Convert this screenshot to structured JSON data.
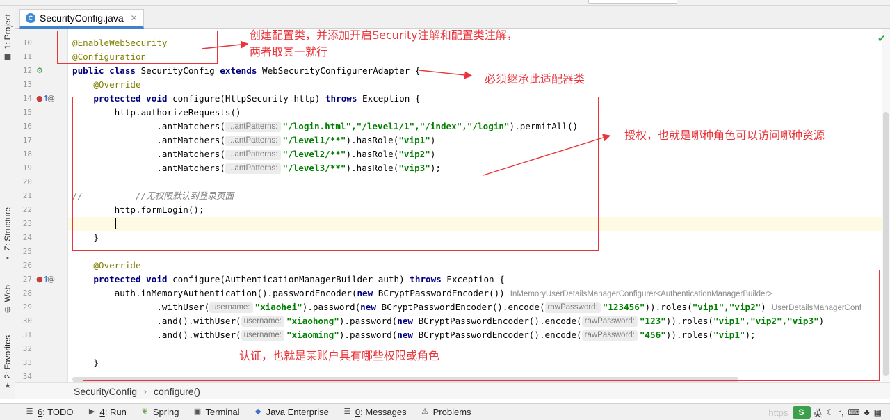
{
  "tab": {
    "label": "SecurityConfig.java",
    "icon_letter": "C"
  },
  "left_tools": [
    {
      "label": "1: Project"
    },
    {
      "label": "Z: Structure"
    },
    {
      "label": "Web"
    },
    {
      "label": "2: Favorites"
    }
  ],
  "gutter": {
    "line_numbers": [
      "10",
      "11",
      "12",
      "13",
      "14",
      "15",
      "16",
      "17",
      "18",
      "19",
      "20",
      "21",
      "22",
      "23",
      "24",
      "25",
      "26",
      "27",
      "28",
      "29",
      "30",
      "31",
      "32",
      "33",
      "34"
    ],
    "override_marker": "@"
  },
  "code": {
    "l10": "@EnableWebSecurity",
    "l11": "@Configuration",
    "l12_kw": "public class",
    "l12_name": " SecurityConfig ",
    "l12_ext": "extends",
    "l12_base": " WebSecurityConfigurerAdapter {",
    "l13": "@Override",
    "l14_kw": "protected void",
    "l14_mid": " configure(HttpSecurity http) ",
    "l14_throws": "throws",
    "l14_end": " Exception {",
    "l15": "http.authorizeRequests()",
    "am": ".antMatchers(",
    "hint_patterns": "...antPatterns:",
    "l16_str": "\"/login.html\",\"/level1/1\",\"/index\",\"/login\"",
    "l16_end": ").permitAll()",
    "l17_str": "\"/level1/**\"",
    "l17_end_a": ").hasRole(",
    "l17_role": "\"vip1\"",
    "l17_end_b": ")",
    "l18_str": "\"/level2/**\"",
    "l18_role": "\"vip2\"",
    "l19_str": "\"/level3/**\"",
    "l19_role": "\"vip3\"",
    "l19_end": ");",
    "l21_slashes": "//",
    "l21_comment": "//无权限默认到登录页面",
    "l22": "http.formLogin();",
    "l24": "}",
    "l26": "@Override",
    "l27_mid": " configure(AuthenticationManagerBuilder auth) ",
    "l28_a": "auth.inMemoryAuthentication().passwordEncoder(",
    "new": "new",
    "l28_b": " BCryptPasswordEncoder())",
    "l28_type": "InMemoryUserDetailsManagerConfigurer<AuthenticationManagerBuilder>",
    "with_user": ".withUser(",
    "and_with_user": ".and().withUser(",
    "hint_username": "username:",
    "hint_rawpw": "rawPassword:",
    "pw_a": ").password(",
    "pw_b": " BCryptPasswordEncoder().encode(",
    "roles": ")).roles(",
    "u1": "\"xiaohei\"",
    "p1": "\"123456\"",
    "r1": "\"vip1\",\"vip2\"",
    "l29_end": ")",
    "l29_type": "UserDetailsManagerConf",
    "u2": "\"xiaohong\"",
    "p2": "\"123\"",
    "r2": "\"vip1\",\"vip2\",\"vip3\"",
    "u3": "\"xiaoming\"",
    "p3": "\"456\"",
    "r3": "\"vip1\"",
    "l31_end": ");",
    "l33": "}"
  },
  "annotations": {
    "a1_line1": "创建配置类，并添加开启Security注解和配置类注解，",
    "a1_line2": "两者取其一就行",
    "a2": "必须继承此适配器类",
    "a3": "授权，也就是哪种角色可以访问哪种资源",
    "a4": "认证，也就是某账户具有哪些权限或角色",
    "color": "#e8343a"
  },
  "breadcrumb": {
    "class_name": "SecurityConfig",
    "method": "configure()"
  },
  "bottom_tools": [
    {
      "num": "6",
      "label": ": TODO",
      "icon": "list-icon"
    },
    {
      "num": "4",
      "label": ": Run",
      "icon": "play-icon"
    },
    {
      "num": "",
      "label": "Spring",
      "icon": "spring-icon"
    },
    {
      "num": "",
      "label": "Terminal",
      "icon": "terminal-icon"
    },
    {
      "num": "",
      "label": "Java Enterprise",
      "icon": "java-icon"
    },
    {
      "num": "0",
      "label": ": Messages",
      "icon": "messages-icon"
    },
    {
      "num": "",
      "label": "Problems",
      "icon": "warning-icon"
    }
  ],
  "tray": {
    "watermark": "https",
    "ime_logo": "S",
    "ime_lang": "英"
  }
}
